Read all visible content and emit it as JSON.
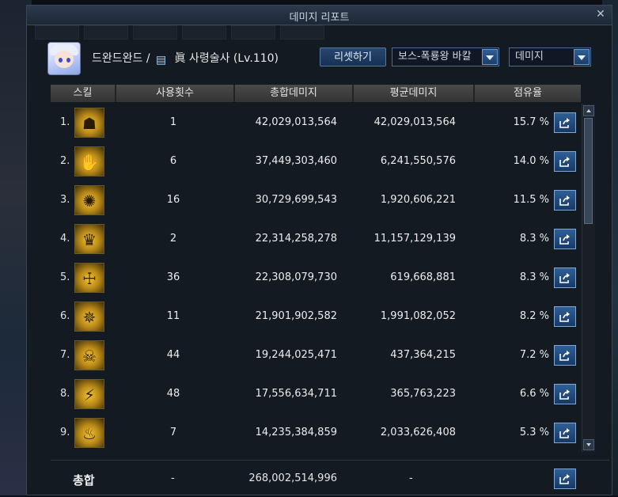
{
  "window": {
    "title": "데미지 리포트"
  },
  "character": {
    "name": "드완드완드",
    "separator": "/",
    "class_icon": "scroll-icon",
    "class_text": "眞 사령술사 (Lv.110)"
  },
  "controls": {
    "reset_label": "리셋하기",
    "target_select": "보스-폭룡왕 바칼",
    "metric_select": "데미지"
  },
  "table": {
    "headers": [
      "스킬",
      "사용횟수",
      "총합데미지",
      "평균데미지",
      "점유율"
    ],
    "rows": [
      {
        "num": "1.",
        "icon": "golden-mask-icon",
        "uses": "1",
        "total": "42,029,013,564",
        "avg": "42,029,013,564",
        "share": "15.7 %"
      },
      {
        "num": "2.",
        "icon": "claw-hand-icon",
        "uses": "6",
        "total": "37,449,303,460",
        "avg": "6,241,550,576",
        "share": "14.0 %"
      },
      {
        "num": "3.",
        "icon": "dark-web-icon",
        "uses": "16",
        "total": "30,729,699,543",
        "avg": "1,920,606,221",
        "share": "11.5 %"
      },
      {
        "num": "4.",
        "icon": "winged-figure-icon",
        "uses": "2",
        "total": "22,314,258,278",
        "avg": "11,157,129,139",
        "share": "8.3 %"
      },
      {
        "num": "5.",
        "icon": "skeletal-hand-icon",
        "uses": "36",
        "total": "22,308,079,730",
        "avg": "619,668,881",
        "share": "8.3 %"
      },
      {
        "num": "6.",
        "icon": "cracked-sigil-icon",
        "uses": "11",
        "total": "21,901,902,582",
        "avg": "1,991,082,052",
        "share": "8.2 %"
      },
      {
        "num": "7.",
        "icon": "beast-head-icon",
        "uses": "44",
        "total": "19,244,025,471",
        "avg": "437,364,215",
        "share": "7.2 %"
      },
      {
        "num": "8.",
        "icon": "slash-streaks-icon",
        "uses": "48",
        "total": "17,556,634,711",
        "avg": "365,763,223",
        "share": "6.6 %"
      },
      {
        "num": "9.",
        "icon": "rising-spirit-icon",
        "uses": "7",
        "total": "14,235,384,859",
        "avg": "2,033,626,408",
        "share": "5.3 %"
      }
    ]
  },
  "total": {
    "label": "총합",
    "uses": "-",
    "total": "268,002,514,996",
    "avg": "-"
  }
}
